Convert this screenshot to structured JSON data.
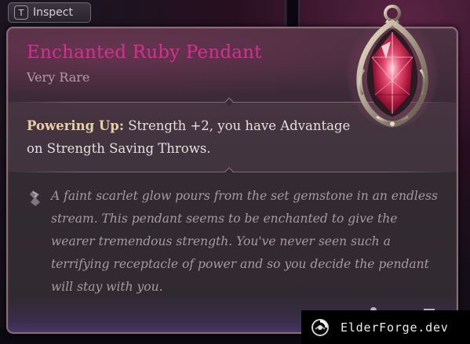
{
  "inspect": {
    "key": "T",
    "label": "Inspect"
  },
  "item": {
    "name": "Enchanted Ruby Pendant",
    "rarity": "Very Rare",
    "rarity_color": "#d52f90",
    "passive": {
      "name": "Powering Up:",
      "text": "Strength +2, you have Advantage on Strength Saving Throws."
    },
    "flavor": "A faint scarlet glow pours from the set gemstone in an endless stream. This pendant seems to be enchanted to give the wearer tremendous strength. You've never seen such a terrifying receptacle of power and so you decide the pendant will stay with you.",
    "image": "ruby-pendant-icon"
  },
  "watermark": {
    "logo": "elderforge-logo-icon",
    "text": "ElderForge.dev"
  },
  "colors": {
    "title": "#d52f90",
    "passive_name": "#e9cfa6",
    "flavor": "#a49ba0",
    "panel_border": "#8a6c78"
  }
}
